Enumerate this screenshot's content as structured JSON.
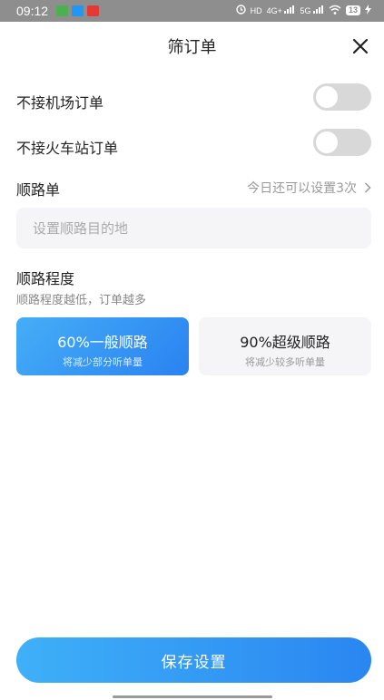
{
  "status_bar": {
    "time": "09:12",
    "network_labels": [
      "HD",
      "4G+",
      "5G"
    ],
    "battery": "13"
  },
  "header": {
    "title": "筛订单"
  },
  "settings": {
    "no_airport_label": "不接机场订单",
    "no_airport_enabled": false,
    "no_station_label": "不接火车站订单",
    "no_station_enabled": false
  },
  "route_order": {
    "label": "顺路单",
    "hint": "今日还可以设置3次",
    "destination_placeholder": "设置顺路目的地"
  },
  "route_degree": {
    "title": "顺路程度",
    "subtitle": "顺路程度越低，订单越多",
    "options": [
      {
        "title": "60%一般顺路",
        "desc": "将减少部分听单量",
        "selected": true
      },
      {
        "title": "90%超级顺路",
        "desc": "将减少较多听单量",
        "selected": false
      }
    ]
  },
  "footer": {
    "save_label": "保存设置"
  },
  "colors": {
    "accent": "#2a86f1",
    "toggle_off": "#d8d8d8",
    "status_bar": "#8e8e8e"
  }
}
